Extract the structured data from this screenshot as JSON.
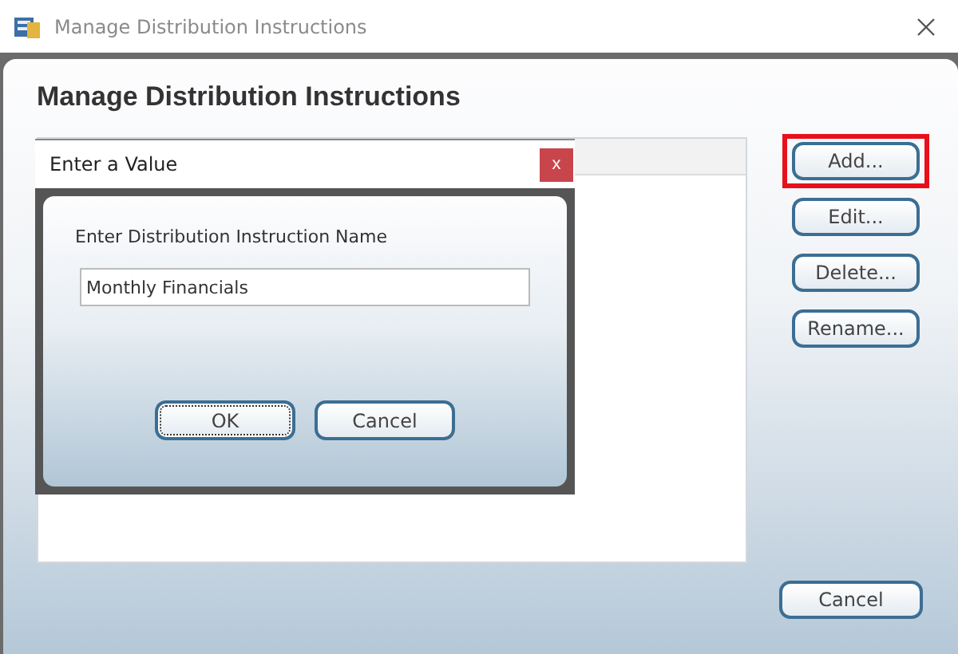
{
  "window": {
    "title": "Manage Distribution Instructions"
  },
  "heading": "Manage Distribution Instructions",
  "side_buttons": [
    {
      "label": "Add...",
      "highlighted": true
    },
    {
      "label": "Edit...",
      "highlighted": false
    },
    {
      "label": "Delete...",
      "highlighted": false
    },
    {
      "label": "Rename...",
      "highlighted": false
    }
  ],
  "cancel_button": "Cancel",
  "dialog": {
    "title": "Enter a Value",
    "close": "x",
    "prompt": "Enter Distribution Instruction Name",
    "value": "Monthly Financials",
    "buttons": [
      {
        "label": "OK",
        "focused": true
      },
      {
        "label": "Cancel",
        "focused": false
      }
    ]
  }
}
